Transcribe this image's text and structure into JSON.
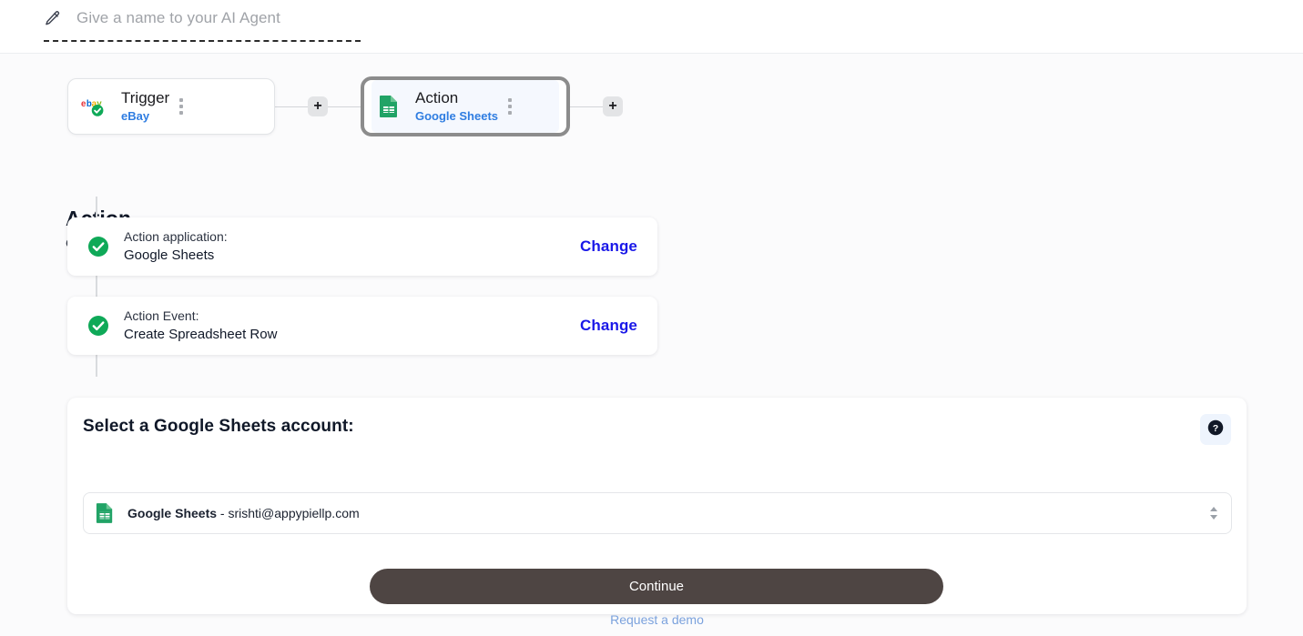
{
  "header": {
    "agent_name_placeholder": "Give a name to your AI Agent",
    "edit_icon": "pencil-icon"
  },
  "flow": {
    "nodes": [
      {
        "kind": "trigger",
        "title": "Trigger",
        "app": "eBay",
        "icon": "ebay-logo-icon",
        "status_icon": "green-check-badge-icon",
        "selected": false
      },
      {
        "kind": "action",
        "title": "Action",
        "app": "Google Sheets",
        "icon": "google-sheets-icon",
        "selected": true
      }
    ],
    "add_button_label": "+"
  },
  "section": {
    "title": "Action",
    "subtitle": "Cause of result"
  },
  "steps": [
    {
      "label": "Action application:",
      "value": "Google Sheets",
      "action_label": "Change",
      "status_icon": "green-check-icon"
    },
    {
      "label": "Action Event:",
      "value": "Create Spreadsheet Row",
      "action_label": "Change",
      "status_icon": "green-check-icon"
    }
  ],
  "panel": {
    "title": "Select a Google Sheets account:",
    "help_icon": "question-mark-circle-icon",
    "account_select": {
      "app_name": "Google Sheets",
      "separator": " - ",
      "email": "srishti@appypiellp.com",
      "icon": "google-sheets-icon",
      "arrows_icon": "chevron-up-down-icon"
    },
    "continue_label": "Continue",
    "demo_link_label": "Request a demo"
  },
  "colors": {
    "accent_blue": "#1a18e8",
    "link_blue": "#2f7de1",
    "demo_link_blue": "#7ba2dd",
    "success_green": "#0fa958",
    "continue_bg": "#4e4543",
    "selected_node_border": "#8c8c8c",
    "canvas_bg": "#fbfbfc"
  }
}
